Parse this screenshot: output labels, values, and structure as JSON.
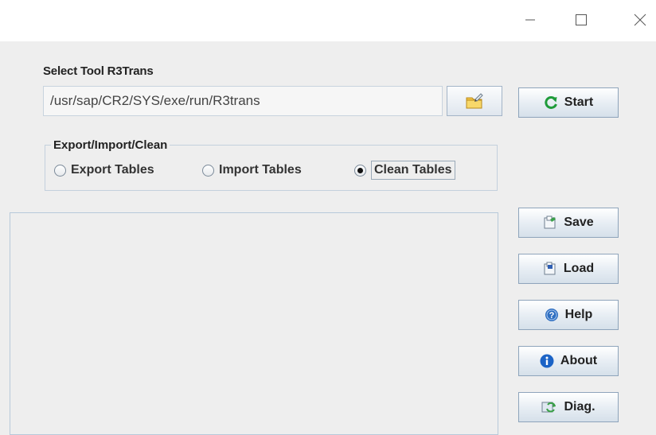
{
  "window": {
    "controls": [
      "minimize-icon",
      "maximize-icon",
      "close-icon"
    ]
  },
  "tool": {
    "label": "Select Tool R3Trans",
    "path": "/usr/sap/CR2/SYS/exe/run/R3trans",
    "browse_icon": "folder-edit-icon"
  },
  "mode_group": {
    "title": "Export/Import/Clean",
    "options": [
      {
        "label": "Export Tables",
        "selected": false
      },
      {
        "label": "Import Tables",
        "selected": false
      },
      {
        "label": "Clean Tables",
        "selected": true
      }
    ]
  },
  "buttons": {
    "start": "Start",
    "save": "Save",
    "load": "Load",
    "help": "Help",
    "about": "About",
    "diag": "Diag."
  },
  "colors": {
    "start_icon": "#1f9b3a",
    "help_icon": "#2f6fc1",
    "about_icon": "#1b63c6"
  }
}
